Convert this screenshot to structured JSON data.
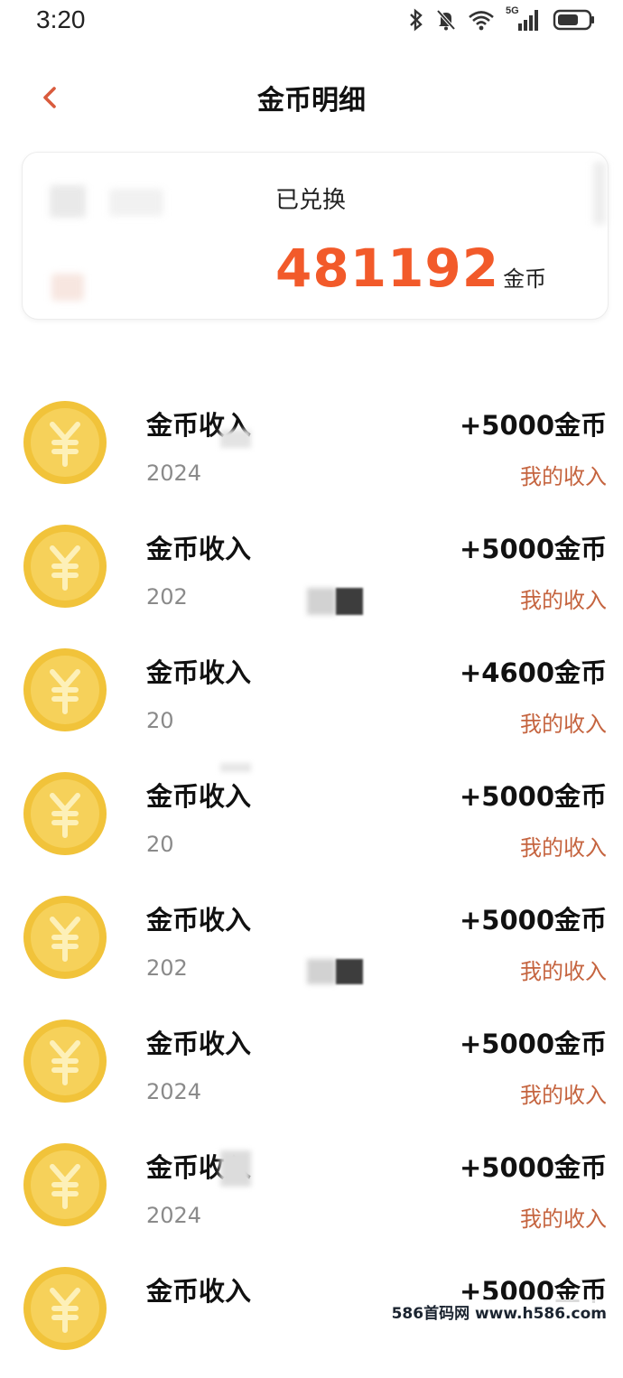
{
  "status_bar": {
    "time": "3:20",
    "network": "5G",
    "icons": [
      "bluetooth-icon",
      "bell-muted-icon",
      "wifi-icon",
      "signal-icon",
      "battery-icon"
    ]
  },
  "nav": {
    "back_icon": "chevron-left-icon",
    "title": "金币明细"
  },
  "summary": {
    "label": "已兑换",
    "amount": "481192",
    "unit": "金币"
  },
  "transactions": [
    {
      "title": "金币收入",
      "date": "2024",
      "amount": "+5000金币",
      "source": "我的收入"
    },
    {
      "title": "金币收入",
      "date": "202",
      "amount": "+5000金币",
      "source": "我的收入"
    },
    {
      "title": "金币收入",
      "date": "20",
      "amount": "+4600金币",
      "source": "我的收入"
    },
    {
      "title": "金币收入",
      "date": "20",
      "amount": "+5000金币",
      "source": "我的收入"
    },
    {
      "title": "金币收入",
      "date": "202",
      "amount": "+5000金币",
      "source": "我的收入"
    },
    {
      "title": "金币收入",
      "date": "2024",
      "amount": "+5000金币",
      "source": "我的收入"
    },
    {
      "title": "金币收入",
      "date": "2024",
      "amount": "+5000金币",
      "source": "我的收入"
    },
    {
      "title": "金币收入",
      "date": "",
      "amount": "+5000金币",
      "source": ""
    }
  ],
  "colors": {
    "accent": "#f25a2a",
    "source_text": "#c5643f",
    "coin_gold": "#f2c53d"
  },
  "watermark": "586首码网 www.h586.com"
}
